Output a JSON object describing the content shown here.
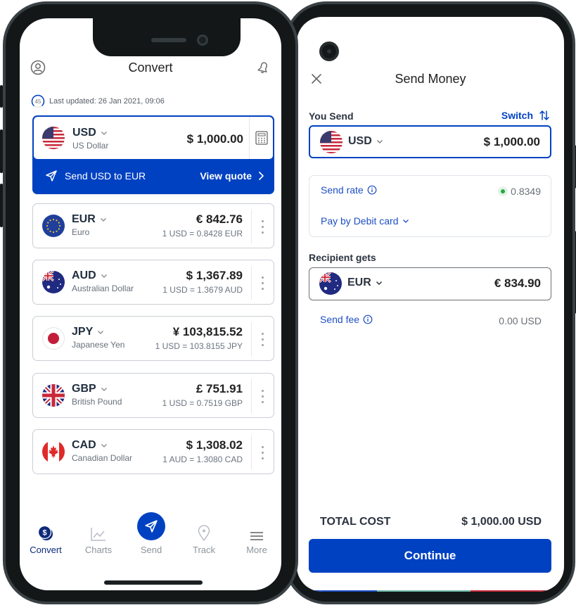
{
  "convert_screen": {
    "title": "Convert",
    "icons": {
      "profile": "profile-icon",
      "notifications": "bell-icon",
      "refresh_timer": "countdown-timer-icon"
    },
    "timer_value": "45",
    "timer_progress": 0.75,
    "last_updated": "Last updated: 26 Jan 2021, 09:06",
    "base_currency": {
      "code": "USD",
      "name": "US Dollar",
      "amount": "$ 1,000.00",
      "flag": "us-flag",
      "send_label": "Send USD to EUR",
      "view_quote_label": "View quote"
    },
    "currencies": [
      {
        "code": "EUR",
        "name": "Euro",
        "amount": "€ 842.76",
        "rate": "1 USD = 0.8428 EUR",
        "flag": "eu-flag"
      },
      {
        "code": "AUD",
        "name": "Australian Dollar",
        "amount": "$ 1,367.89",
        "rate": "1 USD = 1.3679 AUD",
        "flag": "au-flag"
      },
      {
        "code": "JPY",
        "name": "Japanese Yen",
        "amount": "¥ 103,815.52",
        "rate": "1 USD = 103.8155 JPY",
        "flag": "jp-flag"
      },
      {
        "code": "GBP",
        "name": "British Pound",
        "amount": "£ 751.91",
        "rate": "1 USD = 0.7519 GBP",
        "flag": "gb-flag"
      },
      {
        "code": "CAD",
        "name": "Canadian Dollar",
        "amount": "$ 1,308.02",
        "rate": "1 AUD = 1.3080 CAD",
        "flag": "ca-flag"
      }
    ],
    "tabs": [
      {
        "label": "Convert",
        "icon": "dollar-coins-icon",
        "active": true
      },
      {
        "label": "Charts",
        "icon": "line-chart-icon",
        "active": false
      },
      {
        "label": "Send",
        "icon": "paper-plane-icon",
        "active": false
      },
      {
        "label": "Track",
        "icon": "location-pin-icon",
        "active": false
      },
      {
        "label": "More",
        "icon": "hamburger-menu-icon",
        "active": false
      }
    ]
  },
  "send_screen": {
    "title": "Send Money",
    "you_send_label": "You Send",
    "switch_label": "Switch",
    "send_currency": {
      "code": "USD",
      "amount": "$ 1,000.00",
      "flag": "us-flag"
    },
    "send_rate_label": "Send rate",
    "send_rate_value": "0.8349",
    "payment_method": "Pay by Debit card",
    "recipient_gets_label": "Recipient gets",
    "receive_currency": {
      "code": "EUR",
      "amount": "€ 834.90",
      "flag": "au-flag"
    },
    "send_fee_label": "Send fee",
    "send_fee_value": "0.00 USD",
    "total_cost_label": "TOTAL COST",
    "total_cost_value": "$ 1,000.00 USD",
    "continue_label": "Continue"
  },
  "colors": {
    "brand_blue": "#0041c2",
    "link_blue": "#1d4fc4",
    "active_tab": "#0d2a7a",
    "live_green": "#1fae3d",
    "frame": "#131718"
  }
}
